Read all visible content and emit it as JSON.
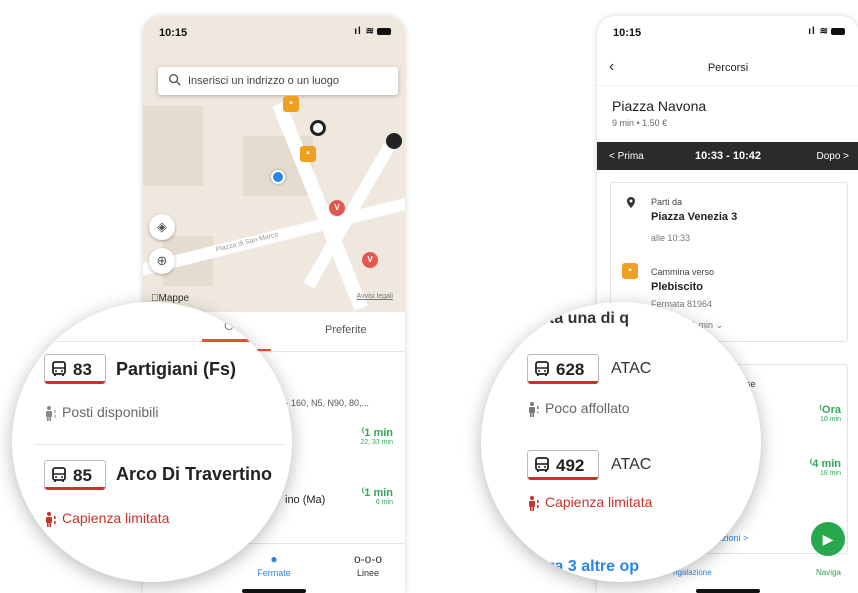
{
  "left_phone": {
    "status_time": "10:15",
    "search_placeholder": "Inserisci un indrizzo o un luogo",
    "map_street_label": "Piazza di San Marco",
    "maps_attribution": "Mappe",
    "legal_link": "Avvisi legali",
    "tab_favorites": "Preferite",
    "row1_routes_fragment": "edi · 160, N5, N90, 80,...",
    "row1_eta": "1 min",
    "row1_eta_next": "22, 33 min",
    "row2_name_fragment": "ino (Ma)",
    "row2_eta": "1 min",
    "row2_eta_next": "6 min",
    "bottom_nav": {
      "stops_label": "Fermate",
      "lines_label": "Linee",
      "left_fragment": "ni"
    }
  },
  "left_magnifier": {
    "tab_fragment": "O",
    "rows": [
      {
        "line": "83",
        "stop": "Partigiani (Fs)",
        "crowding": "Posti disponibili",
        "crowding_level": "available"
      },
      {
        "line": "85",
        "stop": "Arco Di Travertino",
        "crowding": "Capienza limitata",
        "crowding_level": "limited"
      }
    ]
  },
  "right_phone": {
    "status_time": "10:15",
    "header_title": "Percorsi",
    "destination": "Piazza Navona",
    "destination_meta": "9 min • 1.50 €",
    "time_bar": {
      "prev": "< Prima",
      "range": "10:33 - 10:42",
      "next": "Dopo >"
    },
    "steps": [
      {
        "label": "Parti da",
        "place": "Piazza Venezia 3",
        "detail": "alle 10:33"
      },
      {
        "label": "Cammina verso",
        "place": "Plebiscito",
        "detail": "Fermata 81964"
      }
    ],
    "walk_fragment": "1 min ⌄",
    "upcoming_fragment": "ste corse",
    "eta1": "Ora",
    "eta1_next": "10 min",
    "eta2": "4 min",
    "eta2_next": "18 min",
    "options_fragment": "pzioni >",
    "bottom_left_fragment": "ngalazione",
    "navigate_label": "Naviga"
  },
  "right_magnifier": {
    "top_fragment": "ta una di q",
    "rows": [
      {
        "line": "628",
        "agency": "ATAC",
        "crowding": "Poco affollato",
        "crowding_level": "moderate"
      },
      {
        "line": "492",
        "agency": "ATAC",
        "crowding": "Capienza limitata",
        "crowding_level": "limited"
      }
    ],
    "bottom_fragment": "tra 3 altre op"
  },
  "colors": {
    "accent_red": "#c8342c",
    "eta_green": "#2eab5a",
    "link_blue": "#2a86e8",
    "tab_orange": "#e35230",
    "stop_yellow": "#f0a020"
  }
}
